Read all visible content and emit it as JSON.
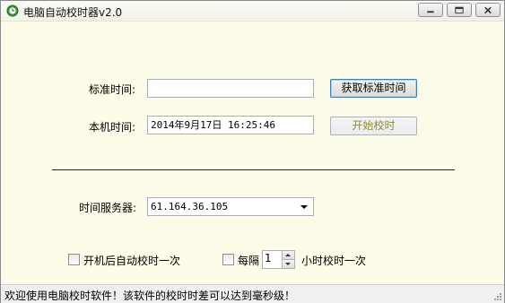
{
  "window": {
    "title": "电脑自动校时器v2.0",
    "icon": "clock-app-icon"
  },
  "title_buttons": {
    "minimize": "minimize-icon",
    "maximize": "maximize-icon",
    "close": "close-icon"
  },
  "standard_time": {
    "label": "标准时间:",
    "value": ""
  },
  "local_time": {
    "label": "本机时间:",
    "value": "2014年9月17日  16:25:46"
  },
  "buttons": {
    "get_standard_time": "获取标准时间",
    "start_sync": "开始校时"
  },
  "time_server": {
    "label": "时间服务器:",
    "selected": "61.164.36.105"
  },
  "options": {
    "auto_on_boot_label": "开机后自动校时一次",
    "auto_on_boot_checked": false,
    "every_label": "每隔",
    "every_checked": false,
    "interval_value": "1",
    "interval_suffix": "小时校时一次"
  },
  "status": {
    "text": "欢迎使用电脑校时软件！该软件的校时时差可以达到毫秒级！"
  },
  "colors": {
    "window_bg": "#fcfce8",
    "disabled_text": "#8c8a3a"
  }
}
